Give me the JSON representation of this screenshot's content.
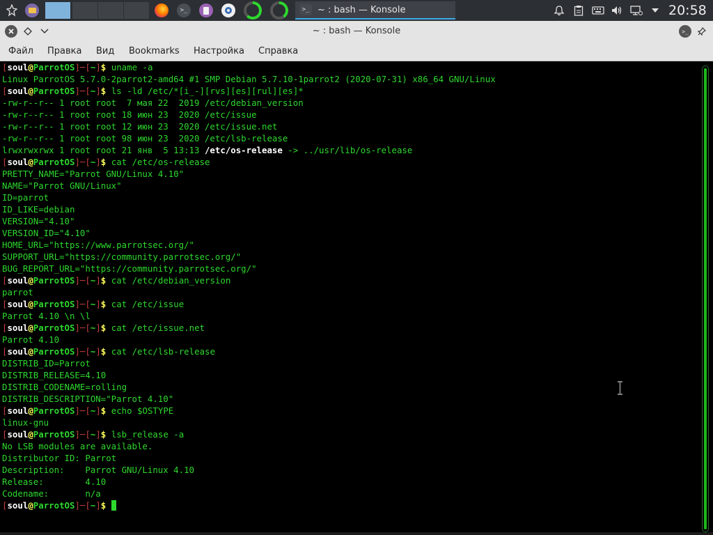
{
  "panel": {
    "task_title": "~ : bash — Konsole",
    "clock": "20:58",
    "launchers": [
      "app-menu-icon",
      "file-manager-icon",
      "firefox-icon",
      "konsole-icon",
      "text-editor-icon",
      "settings-icon",
      "system-monitor-icon",
      "system-monitor-icon"
    ],
    "tray": [
      "notifications-icon",
      "clipboard-icon",
      "keyboard-icon",
      "volume-icon",
      "network-icon",
      "expand-tray-icon"
    ]
  },
  "window": {
    "title": "~ : bash — Konsole",
    "buttons": [
      "close-icon",
      "keep-above-icon",
      "menu-chevron-icon"
    ]
  },
  "menubar": {
    "items": [
      "Файл",
      "Правка",
      "Вид",
      "Bookmarks",
      "Настройка",
      "Справка"
    ]
  },
  "prompt": {
    "open": "[",
    "user": "soul",
    "at": "@",
    "host": "ParrotOS",
    "sep": "]─[",
    "path": "~",
    "close": "]",
    "dollar": "$"
  },
  "terminal": {
    "lines": [
      {
        "t": "p",
        "cmd": "uname -a"
      },
      {
        "t": "o",
        "text": "Linux ParrotOS 5.7.0-2parrot2-amd64 #1 SMP Debian 5.7.10-1parrot2 (2020-07-31) x86_64 GNU/Linux"
      },
      {
        "t": "p",
        "cmd": "ls -ld /etc/*[i_-][rvs][es][rul][es]*"
      },
      {
        "t": "o",
        "text": "-rw-r--r-- 1 root root  7 мая 22  2019 /etc/debian_version"
      },
      {
        "t": "o",
        "text": "-rw-r--r-- 1 root root 18 июн 23  2020 /etc/issue"
      },
      {
        "t": "o",
        "text": "-rw-r--r-- 1 root root 12 июн 23  2020 /etc/issue.net"
      },
      {
        "t": "o",
        "text": "-rw-r--r-- 1 root root 98 июн 23  2020 /etc/lsb-release"
      },
      {
        "t": "l",
        "pre": "lrwxrwxrwx 1 root root 21 янв  5 13:13 ",
        "link": "/etc/os-release",
        "post": " -> ../usr/lib/os-release"
      },
      {
        "t": "p",
        "cmd": "cat /etc/os-release"
      },
      {
        "t": "o",
        "text": "PRETTY_NAME=\"Parrot GNU/Linux 4.10\""
      },
      {
        "t": "o",
        "text": "NAME=\"Parrot GNU/Linux\""
      },
      {
        "t": "o",
        "text": "ID=parrot"
      },
      {
        "t": "o",
        "text": "ID_LIKE=debian"
      },
      {
        "t": "o",
        "text": "VERSION=\"4.10\""
      },
      {
        "t": "o",
        "text": "VERSION_ID=\"4.10\""
      },
      {
        "t": "o",
        "text": "HOME_URL=\"https://www.parrotsec.org/\""
      },
      {
        "t": "o",
        "text": "SUPPORT_URL=\"https://community.parrotsec.org/\""
      },
      {
        "t": "o",
        "text": "BUG_REPORT_URL=\"https://community.parrotsec.org/\""
      },
      {
        "t": "p",
        "cmd": "cat /etc/debian_version"
      },
      {
        "t": "o",
        "text": "parrot"
      },
      {
        "t": "p",
        "cmd": "cat /etc/issue"
      },
      {
        "t": "o",
        "text": "Parrot 4.10 \\n \\l"
      },
      {
        "t": "p",
        "cmd": "cat /etc/issue.net"
      },
      {
        "t": "o",
        "text": "Parrot 4.10"
      },
      {
        "t": "p",
        "cmd": "cat /etc/lsb-release"
      },
      {
        "t": "o",
        "text": "DISTRIB_ID=Parrot"
      },
      {
        "t": "o",
        "text": "DISTRIB_RELEASE=4.10"
      },
      {
        "t": "o",
        "text": "DISTRIB_CODENAME=rolling"
      },
      {
        "t": "o",
        "text": "DISTRIB_DESCRIPTION=\"Parrot 4.10\""
      },
      {
        "t": "p",
        "cmd": "echo $OSTYPE"
      },
      {
        "t": "o",
        "text": "linux-gnu"
      },
      {
        "t": "p",
        "cmd": "lsb_release -a"
      },
      {
        "t": "o",
        "text": "No LSB modules are available."
      },
      {
        "t": "o",
        "text": "Distributor ID: Parrot"
      },
      {
        "t": "o",
        "text": "Description:    Parrot GNU/Linux 4.10"
      },
      {
        "t": "o",
        "text": "Release:        4.10"
      },
      {
        "t": "o",
        "text": "Codename:       n/a"
      },
      {
        "t": "p",
        "cmd": "",
        "cursor": true
      }
    ]
  },
  "colors": {
    "green": "#2ed82e",
    "red": "#c63f3f",
    "yellow": "#ffff5a",
    "accent": "#3daee9"
  }
}
